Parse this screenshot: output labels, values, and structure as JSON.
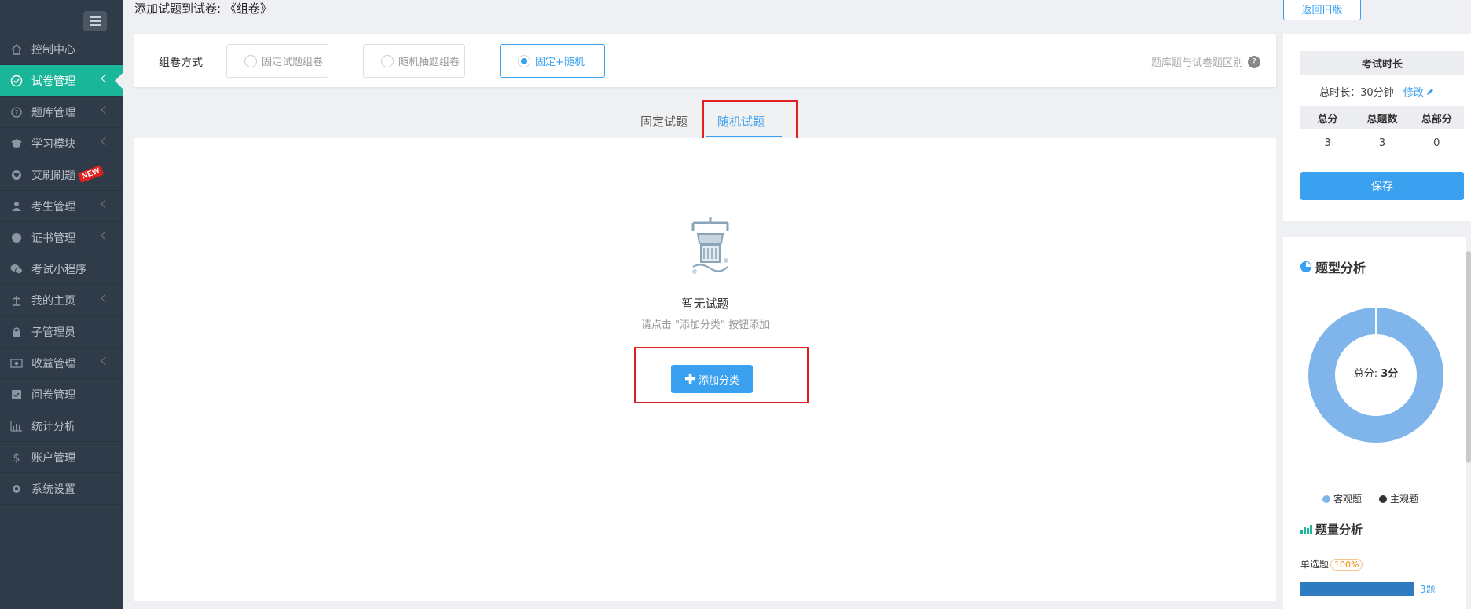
{
  "header": {
    "title": "添加试题到试卷: 《组卷》",
    "back_label": "返回旧版"
  },
  "sidebar": {
    "items": [
      {
        "label": "控制中心",
        "icon": "home-icon",
        "chevron": false,
        "active": false
      },
      {
        "label": "试卷管理",
        "icon": "check-circle-icon",
        "chevron": true,
        "active": true
      },
      {
        "label": "题库管理",
        "icon": "question-circle-icon",
        "chevron": true,
        "active": false
      },
      {
        "label": "学习模块",
        "icon": "graduation-cap-icon",
        "chevron": true,
        "active": false
      },
      {
        "label": "艾刷刷题",
        "icon": "heart-icon",
        "chevron": false,
        "active": false,
        "badge": "NEW"
      },
      {
        "label": "考生管理",
        "icon": "user-icon",
        "chevron": true,
        "active": false
      },
      {
        "label": "证书管理",
        "icon": "certificate-icon",
        "chevron": true,
        "active": false
      },
      {
        "label": "考试小程序",
        "icon": "wechat-icon",
        "chevron": false,
        "active": false
      },
      {
        "label": "我的主页",
        "icon": "home-plant-icon",
        "chevron": true,
        "active": false
      },
      {
        "label": "子管理员",
        "icon": "lock-user-icon",
        "chevron": false,
        "active": false
      },
      {
        "label": "收益管理",
        "icon": "money-icon",
        "chevron": true,
        "active": false
      },
      {
        "label": "问卷管理",
        "icon": "checkbox-icon",
        "chevron": false,
        "active": false
      },
      {
        "label": "统计分析",
        "icon": "bar-chart-icon",
        "chevron": false,
        "active": false
      },
      {
        "label": "账户管理",
        "icon": "dollar-icon",
        "chevron": false,
        "active": false
      },
      {
        "label": "系统设置",
        "icon": "gear-icon",
        "chevron": false,
        "active": false
      }
    ]
  },
  "mode": {
    "label": "组卷方式",
    "options": [
      {
        "label": "固定试题组卷",
        "selected": false
      },
      {
        "label": "随机抽题组卷",
        "selected": false
      },
      {
        "label": "固定+随机",
        "selected": true
      }
    ],
    "diff_link": "题库题与试卷题区别",
    "help_glyph": "?"
  },
  "tabs": [
    {
      "label": "固定试题",
      "active": false
    },
    {
      "label": "随机试题",
      "active": true
    }
  ],
  "empty": {
    "title": "暂无试题",
    "subtitle": "请点击 \"添加分类\" 按钮添加",
    "add_button": "添加分类",
    "plus_glyph": "✚"
  },
  "exam": {
    "duration_title": "考试时长",
    "duration_text": "总时长：30分钟",
    "edit_label": "修改",
    "stats_headers": [
      "总分",
      "总题数",
      "总部分"
    ],
    "stats_values": [
      "3",
      "3",
      "0"
    ],
    "save_label": "保存"
  },
  "analysis": {
    "title": "题型分析",
    "donut_label": "总分: ",
    "donut_value": "3分",
    "objective_share": 1.0,
    "legend": [
      {
        "label": "客观题",
        "color": "#7fb5ea"
      },
      {
        "label": "主观题",
        "color": "#333333"
      }
    ],
    "qty_title": "题量分析",
    "single_label": "单选题",
    "single_pct": "100%",
    "single_fraction": 1.0,
    "single_count": "3题"
  },
  "colors": {
    "accent": "#3aa0f0",
    "active_menu": "#19b69a",
    "sidebar": "#2f3b48",
    "highlight": "#e02020"
  }
}
